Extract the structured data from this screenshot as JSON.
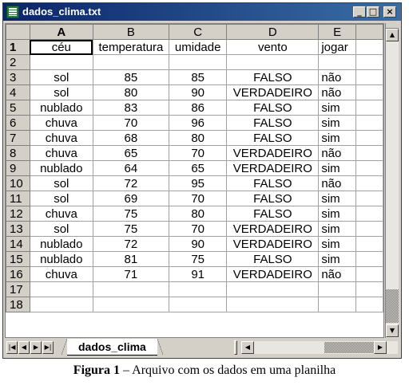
{
  "window": {
    "title": "dados_clima.txt"
  },
  "columns": [
    "A",
    "B",
    "C",
    "D",
    "E"
  ],
  "rows": [
    {
      "num": "1",
      "cells": [
        "céu",
        "temperatura",
        "umidade",
        "vento",
        "jogar"
      ]
    },
    {
      "num": "2",
      "cells": [
        "",
        "",
        "",
        "",
        ""
      ]
    },
    {
      "num": "3",
      "cells": [
        "sol",
        "85",
        "85",
        "FALSO",
        "não"
      ]
    },
    {
      "num": "4",
      "cells": [
        "sol",
        "80",
        "90",
        "VERDADEIRO",
        "não"
      ]
    },
    {
      "num": "5",
      "cells": [
        "nublado",
        "83",
        "86",
        "FALSO",
        "sim"
      ]
    },
    {
      "num": "6",
      "cells": [
        "chuva",
        "70",
        "96",
        "FALSO",
        "sim"
      ]
    },
    {
      "num": "7",
      "cells": [
        "chuva",
        "68",
        "80",
        "FALSO",
        "sim"
      ]
    },
    {
      "num": "8",
      "cells": [
        "chuva",
        "65",
        "70",
        "VERDADEIRO",
        "não"
      ]
    },
    {
      "num": "9",
      "cells": [
        "nublado",
        "64",
        "65",
        "VERDADEIRO",
        "sim"
      ]
    },
    {
      "num": "10",
      "cells": [
        "sol",
        "72",
        "95",
        "FALSO",
        "não"
      ]
    },
    {
      "num": "11",
      "cells": [
        "sol",
        "69",
        "70",
        "FALSO",
        "sim"
      ]
    },
    {
      "num": "12",
      "cells": [
        "chuva",
        "75",
        "80",
        "FALSO",
        "sim"
      ]
    },
    {
      "num": "13",
      "cells": [
        "sol",
        "75",
        "70",
        "VERDADEIRO",
        "sim"
      ]
    },
    {
      "num": "14",
      "cells": [
        "nublado",
        "72",
        "90",
        "VERDADEIRO",
        "sim"
      ]
    },
    {
      "num": "15",
      "cells": [
        "nublado",
        "81",
        "75",
        "FALSO",
        "sim"
      ]
    },
    {
      "num": "16",
      "cells": [
        "chuva",
        "71",
        "91",
        "VERDADEIRO",
        "não"
      ]
    },
    {
      "num": "17",
      "cells": [
        "",
        "",
        "",
        "",
        ""
      ]
    },
    {
      "num": "18",
      "cells": [
        "",
        "",
        "",
        "",
        ""
      ]
    }
  ],
  "sheet_tab": "dados_clima",
  "caption": {
    "label": "Figura 1",
    "text": " – Arquivo com os dados em uma planilha"
  },
  "icons": {
    "app": "spreadsheet-icon",
    "minimize": "minimize-icon",
    "maximize": "maximize-icon",
    "close": "close-icon"
  },
  "colors": {
    "titlebar": "#0a246a",
    "chrome": "#d4d0c8"
  }
}
